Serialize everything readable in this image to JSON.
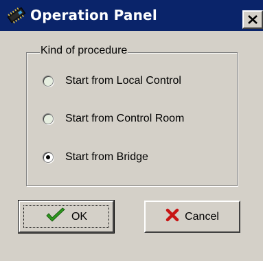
{
  "window": {
    "title": "Operation Panel",
    "icon": "chip-icon",
    "close_icon": "close-icon"
  },
  "group": {
    "legend": "Kind of procedure",
    "options": [
      {
        "label": "Start from Local Control",
        "selected": false
      },
      {
        "label": "Start from Control Room",
        "selected": false
      },
      {
        "label": "Start from Bridge",
        "selected": true
      }
    ]
  },
  "buttons": {
    "ok": {
      "label": "OK",
      "icon": "checkmark-icon",
      "icon_color": "#2e9a1e"
    },
    "cancel": {
      "label": "Cancel",
      "icon": "x-cross-icon",
      "icon_color": "#c81414"
    }
  },
  "colors": {
    "titlebar": "#0a246a",
    "face": "#d4d0c8"
  }
}
